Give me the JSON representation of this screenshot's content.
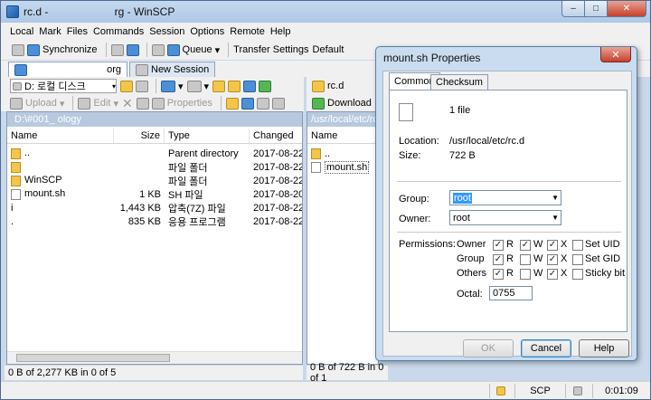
{
  "window": {
    "title": "rc.d -                      rg - WinSCP",
    "min": "–",
    "max": "□",
    "close": "✕"
  },
  "menu": [
    "Local",
    "Mark",
    "Files",
    "Commands",
    "Session",
    "Options",
    "Remote",
    "Help"
  ],
  "toolbar1": {
    "synchronize": "Synchronize",
    "queue": "Queue",
    "transfer_settings": "Transfer Settings",
    "default": "Default"
  },
  "tabs": {
    "session": "org",
    "new_session": "New Session"
  },
  "local": {
    "drive": "D: 로컬 디스크",
    "upload": "Upload",
    "edit": "Edit",
    "properties": "Properties",
    "path": "D:\\#001_                                          ology",
    "headers": {
      "name": "Name",
      "size": "Size",
      "type": "Type",
      "changed": "Changed"
    },
    "rows": [
      {
        "name": "..",
        "size": "",
        "type": "Parent directory",
        "changed": "2017-08-22",
        "icon": "up"
      },
      {
        "name": "",
        "size": "",
        "type": "파일 폴더",
        "changed": "2017-08-22",
        "icon": "fold"
      },
      {
        "name": "WinSCP",
        "size": "",
        "type": "파일 폴더",
        "changed": "2017-08-22",
        "icon": "fold"
      },
      {
        "name": "mount.sh",
        "size": "1 KB",
        "type": "SH 파일",
        "changed": "2017-08-20",
        "icon": "file"
      },
      {
        "name": "i",
        "size": "1,443 KB",
        "type": "압축(7Z) 파일",
        "changed": "2017-08-22",
        "icon": "none"
      },
      {
        "name": ".",
        "size": "835 KB",
        "type": "응용 프로그램",
        "changed": "2017-08-22",
        "icon": "none"
      }
    ],
    "status": "0 B of 2,277 KB in 0 of 5"
  },
  "remote": {
    "folder": "rc.d",
    "download": "Download",
    "path": "/usr/local/etc/rc.d",
    "headers": {
      "name": "Name"
    },
    "rows": [
      {
        "name": "..",
        "icon": "up"
      },
      {
        "name": "mount.sh",
        "icon": "file"
      }
    ],
    "status": "0 B of 722 B in 0 of 1"
  },
  "bottombar": {
    "protocol": "SCP",
    "time": "0:01:09"
  },
  "dialog": {
    "title": "mount.sh Properties",
    "close": "✕",
    "tabs": [
      "Common",
      "Checksum"
    ],
    "file_count": "1 file",
    "location_label": "Location:",
    "location": "/usr/local/etc/rc.d",
    "size_label": "Size:",
    "size": "722 B",
    "group_label": "Group:",
    "group": "root",
    "owner_label": "Owner:",
    "owner": "root",
    "permissions_label": "Permissions:",
    "perm_rows": [
      {
        "label": "Owner",
        "r": true,
        "w": true,
        "x": true,
        "special": "Set UID",
        "special_checked": false
      },
      {
        "label": "Group",
        "r": true,
        "w": false,
        "x": true,
        "special": "Set GID",
        "special_checked": false
      },
      {
        "label": "Others",
        "r": true,
        "w": false,
        "x": true,
        "special": "Sticky bit",
        "special_checked": false
      }
    ],
    "perm_letters": {
      "r": "R",
      "w": "W",
      "x": "X"
    },
    "octal_label": "Octal:",
    "octal": "0755",
    "ok": "OK",
    "cancel": "Cancel",
    "help": "Help"
  }
}
